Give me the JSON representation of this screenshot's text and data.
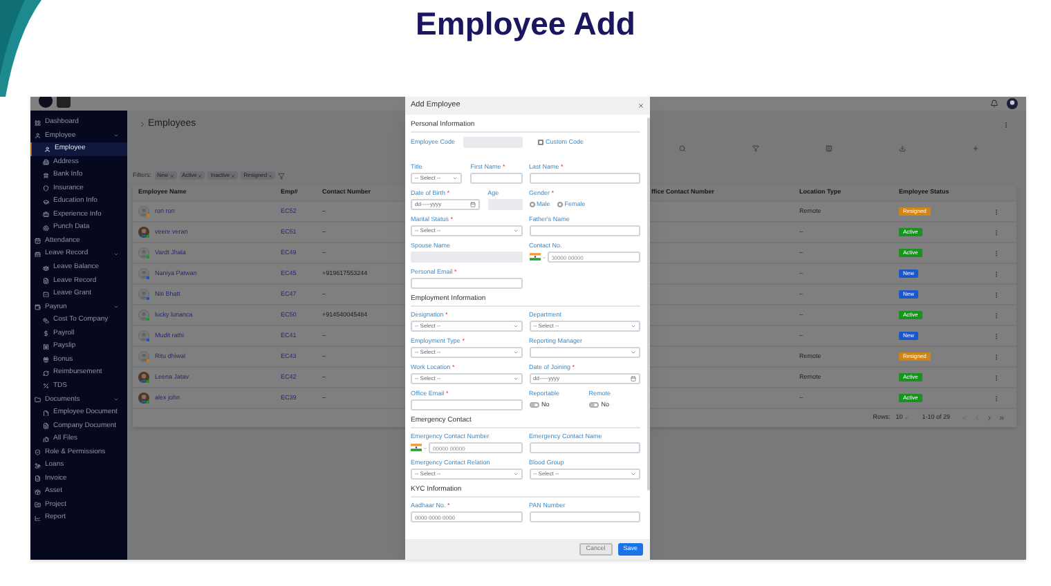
{
  "page_title": "Employee Add",
  "sidebar": {
    "items": [
      {
        "label": "Dashboard",
        "selected": false
      },
      {
        "label": "Employee",
        "selected": false,
        "expanded": true,
        "children": [
          {
            "label": "Employee",
            "selected": true
          },
          {
            "label": "Address",
            "selected": false
          },
          {
            "label": "Bank Info",
            "selected": false
          },
          {
            "label": "Insurance",
            "selected": false
          },
          {
            "label": "Education Info",
            "selected": false
          },
          {
            "label": "Experience Info",
            "selected": false
          },
          {
            "label": "Punch Data",
            "selected": false
          }
        ]
      },
      {
        "label": "Attendance",
        "selected": false
      },
      {
        "label": "Leave Record",
        "selected": false,
        "expanded": true,
        "children": [
          {
            "label": "Leave Balance",
            "selected": false
          },
          {
            "label": "Leave Record",
            "selected": false
          },
          {
            "label": "Leave Grant",
            "selected": false
          }
        ]
      },
      {
        "label": "Payrun",
        "selected": false,
        "expanded": true,
        "children": [
          {
            "label": "Cost To Company",
            "selected": false
          },
          {
            "label": "Payroll",
            "selected": false
          },
          {
            "label": "Payslip",
            "selected": false
          },
          {
            "label": "Bonus",
            "selected": false
          },
          {
            "label": "Reimbursement",
            "selected": false
          },
          {
            "label": "TDS",
            "selected": false
          }
        ]
      },
      {
        "label": "Documents",
        "selected": false,
        "expanded": true,
        "children": [
          {
            "label": "Employee Document",
            "selected": false
          },
          {
            "label": "Company Document",
            "selected": false
          },
          {
            "label": "All Files",
            "selected": false
          }
        ]
      },
      {
        "label": "Role & Permissions",
        "selected": false
      },
      {
        "label": "Loans",
        "selected": false
      },
      {
        "label": "Invoice",
        "selected": false
      },
      {
        "label": "Asset",
        "selected": false
      },
      {
        "label": "Project",
        "selected": false
      },
      {
        "label": "Report",
        "selected": false
      }
    ]
  },
  "page_heading": "Employees",
  "filters": {
    "label": "Filters:",
    "chips": [
      "New",
      "Active",
      "Inactive",
      "Resigned"
    ]
  },
  "table": {
    "columns": [
      "Employee Name",
      "Emp#",
      "Contact Number",
      "ffice Contact Number",
      "Location Type",
      "Employee Status"
    ],
    "rows": [
      {
        "name": "ron ron",
        "kind": "placeholder",
        "color": "#c97a12",
        "emp": "EC52",
        "contact": "–",
        "location": "Remote",
        "status": {
          "label": "Resigned",
          "color": "#d08616"
        }
      },
      {
        "name": "veere veran",
        "kind": "photo",
        "color": "#169a1e",
        "emp": "EC51",
        "contact": "–",
        "location": "–",
        "status": {
          "label": "Active",
          "color": "#17941e"
        }
      },
      {
        "name": "Vardt Jhala",
        "kind": "placeholder",
        "color": "#169a1e",
        "emp": "EC49",
        "contact": "–",
        "location": "–",
        "status": {
          "label": "Active",
          "color": "#17941e"
        }
      },
      {
        "name": "Naniya Patwan",
        "kind": "placeholder",
        "color": "#1c54c8",
        "emp": "EC45",
        "contact": "+919617553244",
        "location": "–",
        "status": {
          "label": "New",
          "color": "#1a56cc"
        }
      },
      {
        "name": "Niti Bhatt",
        "kind": "placeholder",
        "color": "#1c54c8",
        "emp": "EC47",
        "contact": "–",
        "location": "–",
        "status": {
          "label": "New",
          "color": "#1a56cc"
        }
      },
      {
        "name": "lucky lunanca",
        "kind": "placeholder",
        "color": "#169a1e",
        "emp": "EC50",
        "contact": "+914540045484",
        "location": "–",
        "status": {
          "label": "Active",
          "color": "#17941e"
        }
      },
      {
        "name": "Mudit rathi",
        "kind": "placeholder",
        "color": "#1c54c8",
        "emp": "EC41",
        "contact": "–",
        "location": "–",
        "status": {
          "label": "New",
          "color": "#1a56cc"
        }
      },
      {
        "name": "Ritu dhiwal",
        "kind": "placeholder",
        "color": "#c97a12",
        "emp": "EC43",
        "contact": "–",
        "location": "Remote",
        "status": {
          "label": "Resigned",
          "color": "#d08616"
        }
      },
      {
        "name": "Leena Jatav",
        "kind": "photo",
        "color": "#169a1e",
        "emp": "EC42",
        "contact": "–",
        "location": "Remote",
        "status": {
          "label": "Active",
          "color": "#17941e"
        }
      },
      {
        "name": "alex john",
        "kind": "photo",
        "color": "#169a1e",
        "emp": "EC39",
        "contact": "–",
        "location": "–",
        "status": {
          "label": "Active",
          "color": "#17941e"
        }
      }
    ]
  },
  "pagination": {
    "rows_label": "Rows:",
    "rows_value": "10",
    "range": "1-10 of 29"
  },
  "modal": {
    "title": "Add Employee",
    "sections": [
      {
        "title": "Personal Information",
        "rows": [
          {
            "left": [
              {
                "kind": "code",
                "label": "Employee Code"
              }
            ],
            "right": [
              {
                "kind": "checkbox",
                "label": "Custom Code",
                "checked": false
              }
            ]
          },
          {
            "left": [
              {
                "kind": "select",
                "label": "Title",
                "placeholder": "-- Select --"
              },
              {
                "kind": "text",
                "label": "First Name",
                "mark": "*"
              }
            ],
            "right": [
              {
                "kind": "text",
                "label": "Last Name",
                "mark": "*"
              }
            ]
          },
          {
            "left": [
              {
                "kind": "date",
                "label": "Date of Birth",
                "mark": "*",
                "placeholder": "dd-----yyyy"
              },
              {
                "kind": "disabled",
                "label": "Age"
              }
            ],
            "right": [
              {
                "kind": "radio",
                "label": "Gender",
                "mark": "*",
                "options": [
                  {
                    "label": "Male",
                    "selected": false
                  },
                  {
                    "label": "Female",
                    "selected": false
                  }
                ]
              }
            ]
          },
          {
            "left": [
              {
                "kind": "select",
                "label": "Marital Status",
                "mark": "*",
                "placeholder": "-- Select --"
              }
            ],
            "right": [
              {
                "kind": "text",
                "label": "Father's Name"
              }
            ]
          },
          {
            "left": [
              {
                "kind": "disabled",
                "label": "Spouse Name"
              }
            ],
            "right": [
              {
                "kind": "phone",
                "label": "Contact No.",
                "placeholder": "00000 00000"
              }
            ]
          },
          {
            "left": [
              {
                "kind": "text",
                "label": "Personal Email",
                "mark": "*"
              }
            ],
            "right": []
          }
        ]
      },
      {
        "title": "Employment Information",
        "rows": [
          {
            "left": [
              {
                "kind": "select",
                "label": "Designation",
                "mark": "*",
                "placeholder": "-- Select --"
              }
            ],
            "right": [
              {
                "kind": "select",
                "label": "Department",
                "placeholder": "-- Select --"
              }
            ]
          },
          {
            "left": [
              {
                "kind": "select",
                "label": "Employment Type",
                "mark": "*",
                "placeholder": "-- Select --"
              }
            ],
            "right": [
              {
                "kind": "select",
                "label": "Reporting Manager"
              }
            ]
          },
          {
            "left": [
              {
                "kind": "select",
                "label": "Work Location",
                "mark": "*",
                "placeholder": "-- Select --"
              }
            ],
            "right": [
              {
                "kind": "date",
                "label": "Date of Joining",
                "mark": "*",
                "placeholder": "dd-----yyyy"
              }
            ]
          },
          {
            "left": [
              {
                "kind": "text",
                "label": "Office Email",
                "mark": "*"
              }
            ],
            "right": [
              {
                "kind": "toggle",
                "label": "Reportable",
                "on": false,
                "value": "No"
              },
              {
                "kind": "toggle",
                "label": "Remote",
                "on": false,
                "value": "No"
              }
            ]
          }
        ]
      },
      {
        "title": "Emergency Contact",
        "rows": [
          {
            "left": [
              {
                "kind": "phone",
                "label": "Emergency Contact Number",
                "placeholder": "00000 00000"
              }
            ],
            "right": [
              {
                "kind": "text",
                "label": "Emergency Contact Name"
              }
            ]
          },
          {
            "left": [
              {
                "kind": "select",
                "label": "Emergency Contact Relation",
                "placeholder": "-- Select --"
              }
            ],
            "right": [
              {
                "kind": "select",
                "label": "Blood Group",
                "placeholder": "-- Select --"
              }
            ]
          }
        ]
      },
      {
        "title": "KYC Information",
        "rows": [
          {
            "left": [
              {
                "kind": "text",
                "label": "Aadhaar No.",
                "mark": "*",
                "placeholder": "0000 0000 0000"
              }
            ],
            "right": [
              {
                "kind": "text",
                "label": "PAN Number"
              }
            ]
          }
        ]
      }
    ],
    "buttons": [
      {
        "label": "Cancel",
        "kind": "secondary"
      },
      {
        "label": "Save",
        "kind": "primary"
      }
    ]
  }
}
